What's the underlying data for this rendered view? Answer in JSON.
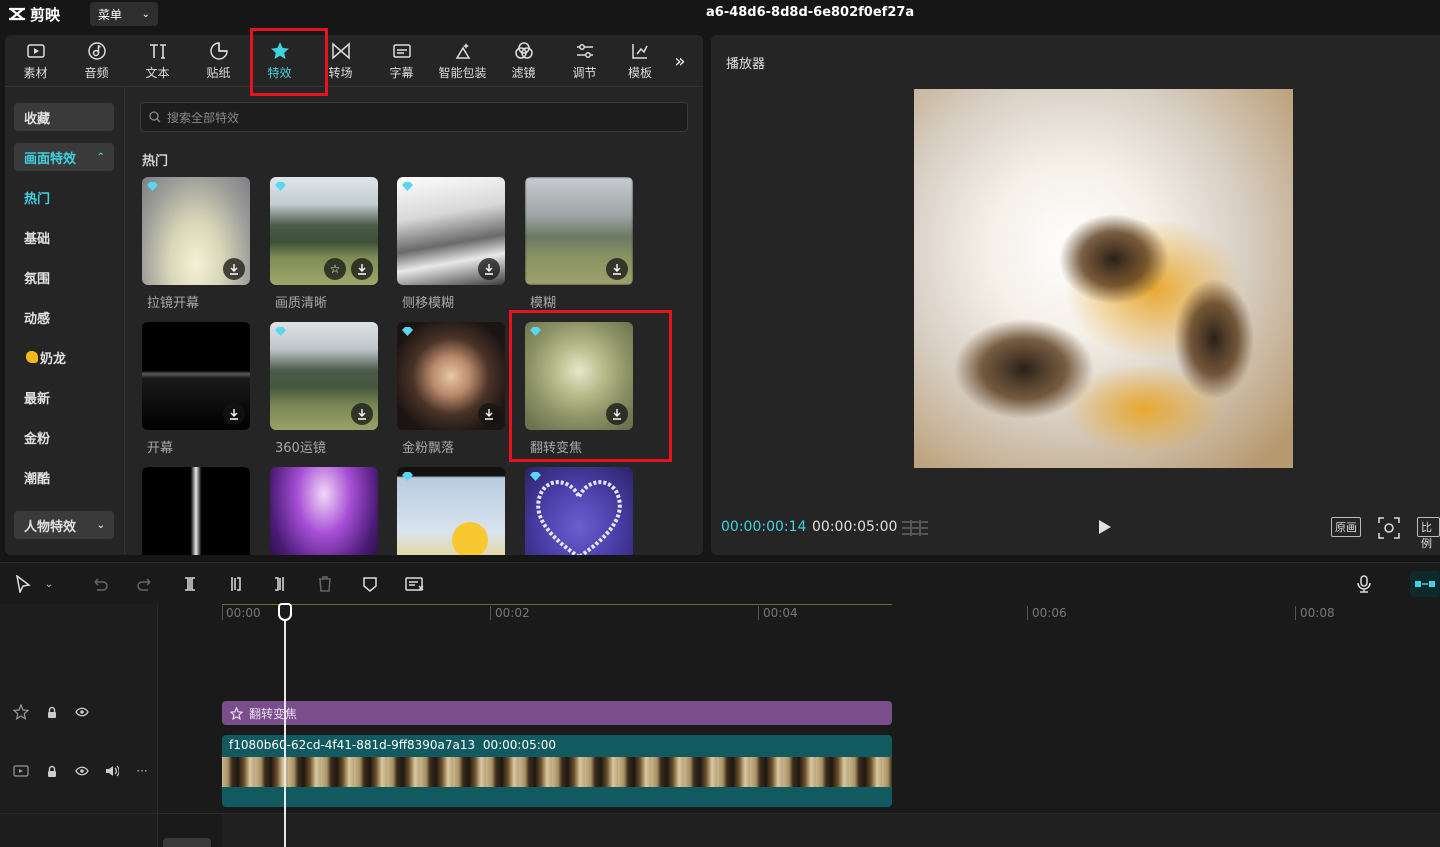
{
  "app": {
    "name": "剪映",
    "menu_label": "菜单",
    "window_title": "a6-48d6-8d8d-6e802f0ef27a"
  },
  "tool_tabs": [
    {
      "label": "素材",
      "icon": "media-icon"
    },
    {
      "label": "音频",
      "icon": "audio-icon"
    },
    {
      "label": "文本",
      "icon": "text-icon"
    },
    {
      "label": "贴纸",
      "icon": "sticker-icon"
    },
    {
      "label": "特效",
      "icon": "effects-star-icon",
      "active": true
    },
    {
      "label": "转场",
      "icon": "transition-icon"
    },
    {
      "label": "字幕",
      "icon": "caption-icon"
    },
    {
      "label": "智能包装",
      "icon": "smart-package-icon"
    },
    {
      "label": "滤镜",
      "icon": "filter-icon"
    },
    {
      "label": "调节",
      "icon": "adjust-icon"
    },
    {
      "label": "模板",
      "icon": "template-icon"
    }
  ],
  "categories": {
    "favorites": "收藏",
    "screen_effects": "画面特效",
    "items": [
      "热门",
      "基础",
      "氛围",
      "动感",
      "奶龙",
      "最新",
      "金粉",
      "潮酷"
    ],
    "person_effects": "人物特效"
  },
  "search": {
    "placeholder": "搜索全部特效"
  },
  "section_title": "热门",
  "effects": [
    {
      "label": "拉镜开幕"
    },
    {
      "label": "画质清晰"
    },
    {
      "label": "侧移模糊"
    },
    {
      "label": "模糊"
    },
    {
      "label": "开幕"
    },
    {
      "label": "360运镜"
    },
    {
      "label": "金粉飘落"
    },
    {
      "label": "翻转变焦"
    },
    {
      "label": ""
    },
    {
      "label": ""
    },
    {
      "label": ""
    },
    {
      "label": ""
    }
  ],
  "player": {
    "title": "播放器",
    "current_time": "00:00:00:14",
    "total_time": "00:00:05:00",
    "btn_original": "原画",
    "btn_ratio": "比例"
  },
  "timeline": {
    "ticks": [
      "00:00",
      "00:02",
      "00:04",
      "00:06",
      "00:08"
    ],
    "effect_clip_label": "翻转变焦",
    "video_clip_title": "f1080b60-62cd-4f41-881d-9ff8390a7a13",
    "video_clip_duration": "00:00:05:00"
  },
  "colors": {
    "accent": "#3ed2e0",
    "highlight": "#e5131e",
    "effect_clip": "#7a4e8b",
    "video_clip": "#115a5f"
  }
}
